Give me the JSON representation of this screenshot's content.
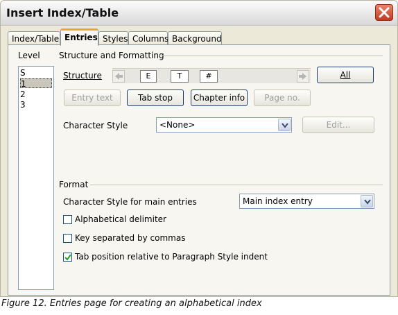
{
  "window": {
    "title": "Insert Index/Table"
  },
  "tabs": [
    "Index/Table",
    "Entries",
    "Styles",
    "Columns",
    "Background"
  ],
  "level": {
    "label": "Level",
    "items": [
      "S",
      "1",
      "2",
      "3"
    ]
  },
  "structure_section": {
    "heading": "Structure and Formatting",
    "structure_label": "Structure",
    "tokens": [
      "E",
      "T",
      "#"
    ],
    "all_button": "All",
    "entry_text_button": "Entry text",
    "tab_stop_button": "Tab stop",
    "chapter_info_button": "Chapter info",
    "page_no_button": "Page no.",
    "char_style_label": "Character Style",
    "char_style_value": "<None>",
    "edit_button": "Edit..."
  },
  "format_section": {
    "heading": "Format",
    "main_entries_label": "Character Style for main entries",
    "main_entries_value": "Main index entry",
    "alphabetical_delimiter": {
      "label": "Alphabetical delimiter",
      "checked": false
    },
    "key_separated": {
      "label": "Key separated by commas",
      "checked": false
    },
    "tab_position": {
      "label": "Tab position relative to Paragraph Style indent",
      "checked": true
    }
  },
  "caption": "Figure 12. Entries page for creating an alphabetical index"
}
